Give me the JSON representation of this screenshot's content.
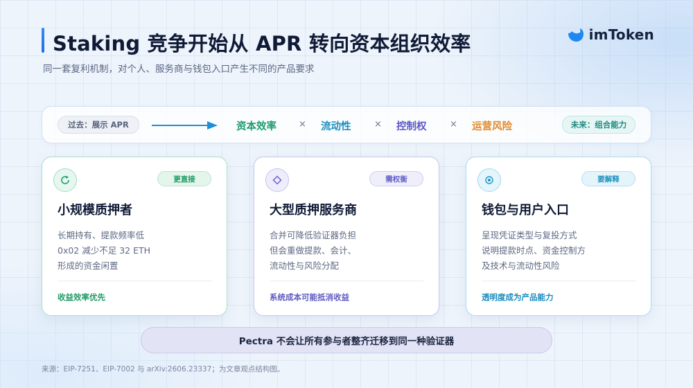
{
  "header": {
    "title": "Staking 竞争开始从 APR 转向资本组织效率",
    "subtitle": "同一套复利机制，对个人、服务商与钱包入口产生不同的产品要求",
    "logo_text": "imToken"
  },
  "flow": {
    "past_label": "过去：展示 APR",
    "future_label": "未来：组合能力",
    "keywords": [
      {
        "label": "资本效率",
        "color": "#1a9b6c"
      },
      {
        "label": "流动性",
        "color": "#1a8fc0"
      },
      {
        "label": "控制权",
        "color": "#5b57c5"
      },
      {
        "label": "运营风险",
        "color": "#e28a2b"
      }
    ],
    "separator": "×"
  },
  "cards": [
    {
      "icon": "refresh-icon",
      "badge": "更直接",
      "title": "小规模质押者",
      "lines": [
        "长期持有、提款频率低",
        "0x02 减少不足 32 ETH",
        "形成的资金闲置"
      ],
      "footer": "收益效率优先"
    },
    {
      "icon": "diamond-icon",
      "badge": "需权衡",
      "title": "大型质押服务商",
      "lines": [
        "合并可降低验证器负担",
        "但会重做提款、会计、",
        "流动性与风险分配"
      ],
      "footer": "系统成本可能抵消收益"
    },
    {
      "icon": "target-icon",
      "badge": "要解释",
      "title": "钱包与用户入口",
      "lines": [
        "呈现凭证类型与复投方式",
        "说明提款时点、资金控制方",
        "及技术与流动性风险"
      ],
      "footer": "透明度成为产品能力"
    }
  ],
  "banner": "Pectra 不会让所有参与者整齐迁移到同一种验证器",
  "source": "来源：EIP-7251、EIP-7002 与 arXiv:2606.23337；为文章观点结构图。",
  "colors": {
    "accent_blue": "#1d6fe0",
    "green": "#1a9b6c",
    "purple": "#5b57c5",
    "cyan": "#1a8fc0",
    "orange": "#e28a2b"
  }
}
